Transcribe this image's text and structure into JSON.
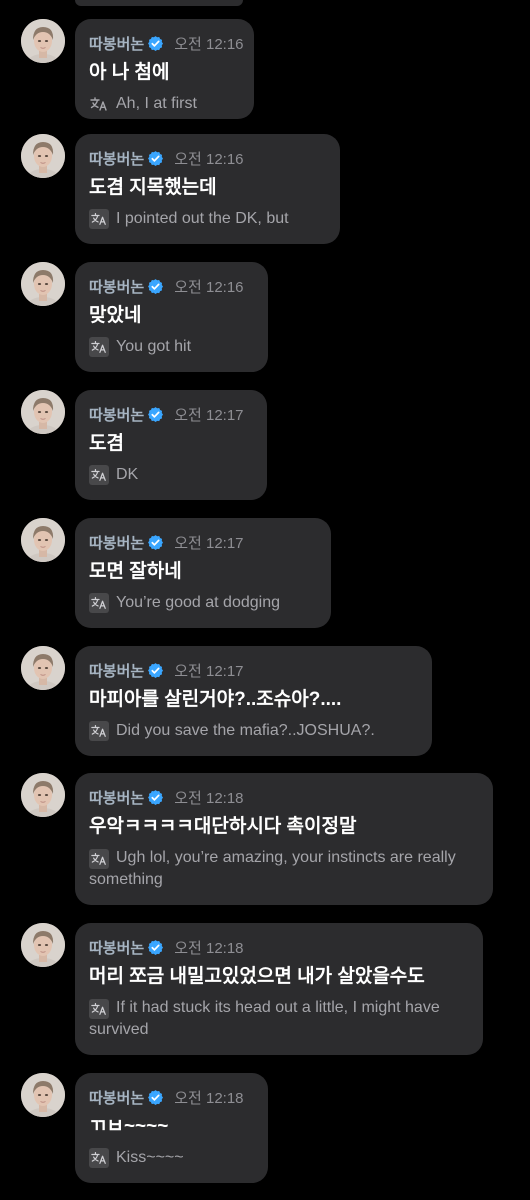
{
  "sender": "따봉버논",
  "icons": {
    "verified": "verified-check-icon",
    "translate": "translate-icon"
  },
  "colors": {
    "background": "#000000",
    "bubble": "#2c2c2e",
    "sender": "#a6b4c2",
    "verified": "#3aa6ff",
    "time": "#8e8e93",
    "text": "#ffffff",
    "translation": "#a5a5aa"
  },
  "messages": [
    {
      "time": "오전 12:16",
      "text": "아 나 첨에",
      "translation": "Ah, I at first"
    },
    {
      "time": "오전 12:16",
      "text": "도겸 지목했는데",
      "translation": "I pointed out the DK, but"
    },
    {
      "time": "오전 12:16",
      "text": "맞았네",
      "translation": "You got hit"
    },
    {
      "time": "오전 12:17",
      "text": "도겸",
      "translation": "DK"
    },
    {
      "time": "오전 12:17",
      "text": "모면 잘하네",
      "translation": "You’re good at dodging"
    },
    {
      "time": "오전 12:17",
      "text": "마피아를 살린거야?..조슈아?....",
      "translation": "Did you save the mafia?..JOSHUA?."
    },
    {
      "time": "오전 12:18",
      "text": "우악ㅋㅋㅋㅋ대단하시다 촉이정말",
      "translation": "Ugh lol, you’re amazing, your instincts are really something"
    },
    {
      "time": "오전 12:18",
      "text": "머리 쪼금 내밀고있었으면 내가 살았을수도",
      "translation": "If it had stuck its head out a little, I might have survived"
    },
    {
      "time": "오전 12:18",
      "text": "ㄲㅂ~~~~",
      "translation": "Kiss~~~~"
    }
  ]
}
